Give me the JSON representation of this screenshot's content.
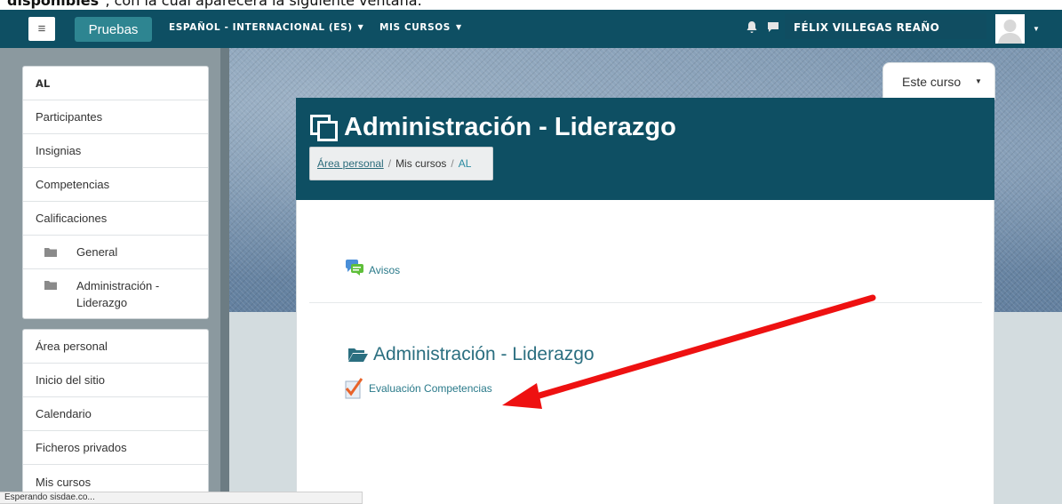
{
  "caption": {
    "bold": "disponibles",
    "rest": "\", con la cual aparecerá la siguiente ventana:"
  },
  "navbar": {
    "menu_glyph": "≡",
    "site_button": "Pruebas",
    "language": "ESPAÑOL - INTERNACIONAL (ES)",
    "my_courses": "MIS CURSOS",
    "user_name": "FÉLIX VILLEGAS REAÑO",
    "icons": [
      "bell-icon",
      "message-icon",
      "avatar",
      "chevron-down-icon"
    ]
  },
  "sidebar": {
    "course_nav": [
      {
        "label": "AL",
        "type": "heading"
      },
      {
        "label": "Participantes"
      },
      {
        "label": "Insignias"
      },
      {
        "label": "Competencias"
      },
      {
        "label": "Calificaciones"
      },
      {
        "label": "General",
        "icon": "folder-icon"
      },
      {
        "label": "Administración - Liderazgo",
        "line1": "Administración -",
        "line2": "Liderazgo",
        "icon": "folder-icon"
      }
    ],
    "site_nav": [
      {
        "label": "Área personal"
      },
      {
        "label": "Inicio del sitio"
      },
      {
        "label": "Calendario"
      },
      {
        "label": "Ficheros privados"
      },
      {
        "label": "Mis cursos"
      }
    ]
  },
  "course_menu": {
    "label": "Este curso"
  },
  "header": {
    "title": "Administración - Liderazgo",
    "breadcrumb": [
      "Área personal",
      "Mis cursos",
      "AL"
    ]
  },
  "content": {
    "announcements": "Avisos",
    "section_title": "Administración - Liderazgo",
    "activity": "Evaluación Competencias"
  },
  "status_bar": "Esperando sisdae.co...",
  "colors": {
    "navbar": "#0e4f63",
    "site_button": "#2e8591",
    "link": "#2a7a8a",
    "arrow": "#ee1111"
  }
}
